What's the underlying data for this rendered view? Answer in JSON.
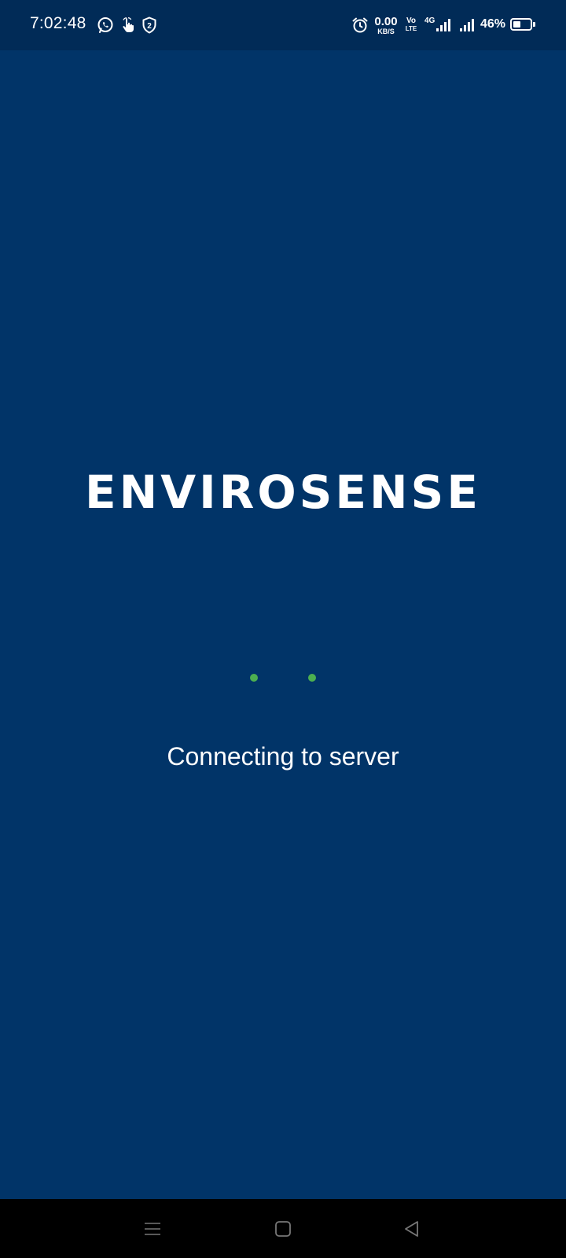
{
  "status_bar": {
    "time": "7:02:48",
    "network_speed_value": "0.00",
    "network_speed_unit": "KB/S",
    "volte_top": "Vo",
    "volte_bottom": "LTE",
    "network_type": "4G",
    "battery_percent": "46%",
    "battery_level": 0.46,
    "notification_icons": [
      "whatsapp-icon",
      "hand-pointer-icon",
      "shield-badge-icon"
    ],
    "system_icons": [
      "alarm-icon",
      "signal-icon",
      "signal-icon",
      "battery-icon"
    ],
    "shield_badge_count": "2"
  },
  "app": {
    "brand_name": "ENVIROSENSE",
    "status_message": "Connecting to server",
    "loader_color": "#4caf50",
    "background_color": "#013468"
  },
  "nav_bar": {
    "buttons": [
      "menu-icon",
      "home-icon",
      "back-icon"
    ]
  }
}
